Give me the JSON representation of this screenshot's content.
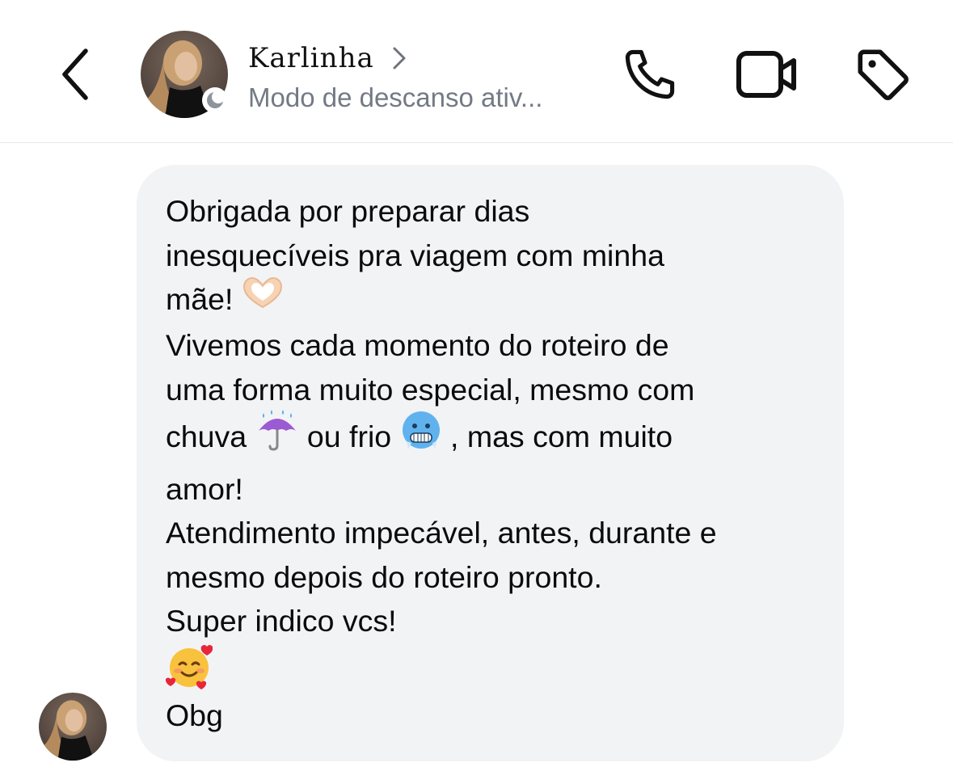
{
  "header": {
    "contact_name": "Karlinha",
    "status_text": "Modo de descanso ativ...",
    "back_icon": "chevron-left-icon",
    "call_icon": "phone-icon",
    "video_icon": "video-camera-icon",
    "tag_icon": "tag-icon"
  },
  "message": {
    "lines1": [
      "Obrigada por preparar dias",
      "inesquecíveis pra viagem com minha",
      "mãe!"
    ],
    "lines2": [
      "Vivemos cada momento do roteiro de",
      "uma forma muito especial, mesmo com"
    ],
    "line2_chuva": "chuva",
    "line2_frio": "ou frio",
    "line2_tail": ", mas com muito",
    "line2_end": "amor!",
    "lines3": [
      "Atendimento impecável, antes, durante e",
      "mesmo depois do roteiro pronto."
    ],
    "line4": "Super indico vcs!",
    "line5": "Obg",
    "emojis": [
      "heart-hands-emoji",
      "umbrella-rain-emoji",
      "cold-face-emoji",
      "smiling-face-with-hearts-emoji"
    ]
  },
  "colors": {
    "bubble_bg": "#f2f3f5",
    "status_gray": "#737a85",
    "text": "#0b0b0b"
  }
}
